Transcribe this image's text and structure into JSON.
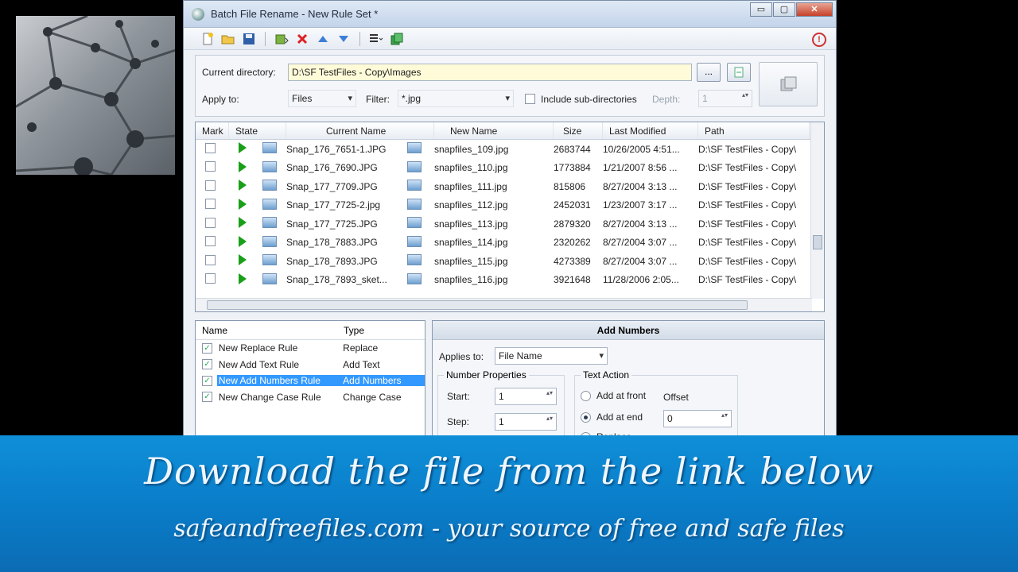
{
  "window": {
    "title": "Batch File Rename - New Rule Set *",
    "controls": [
      "▭",
      "▢",
      "✕"
    ]
  },
  "toolbar": {
    "icons": [
      "new-icon",
      "open-icon",
      "save-icon",
      "add-files-icon",
      "delete-icon",
      "move-up-icon",
      "move-down-icon",
      "list-view-icon",
      "rename-icon"
    ],
    "help": "!"
  },
  "directory": {
    "label": "Current directory:",
    "value": "D:\\SF TestFiles - Copy\\Images",
    "browse_label": "...",
    "apply_label": "Apply to:",
    "apply_value": "Files",
    "filter_label": "Filter:",
    "filter_value": "*.jpg",
    "include_sub_label": "Include sub-directories",
    "depth_label": "Depth:",
    "depth_value": "1"
  },
  "file_table": {
    "columns": [
      "Mark",
      "State",
      "Current Name",
      "New Name",
      "Size",
      "Last Modified",
      "Path"
    ],
    "rows": [
      {
        "current": "Snap_176_7651-1.JPG",
        "new": "snapfiles_109.jpg",
        "size": "2683744",
        "modified": "10/26/2005 4:51...",
        "path": "D:\\SF TestFiles - Copy\\"
      },
      {
        "current": "Snap_176_7690.JPG",
        "new": "snapfiles_110.jpg",
        "size": "1773884",
        "modified": "1/21/2007 8:56 ...",
        "path": "D:\\SF TestFiles - Copy\\"
      },
      {
        "current": "Snap_177_7709.JPG",
        "new": "snapfiles_111.jpg",
        "size": "815806",
        "modified": "8/27/2004 3:13 ...",
        "path": "D:\\SF TestFiles - Copy\\"
      },
      {
        "current": "Snap_177_7725-2.jpg",
        "new": "snapfiles_112.jpg",
        "size": "2452031",
        "modified": "1/23/2007 3:17 ...",
        "path": "D:\\SF TestFiles - Copy\\"
      },
      {
        "current": "Snap_177_7725.JPG",
        "new": "snapfiles_113.jpg",
        "size": "2879320",
        "modified": "8/27/2004 3:13 ...",
        "path": "D:\\SF TestFiles - Copy\\"
      },
      {
        "current": "Snap_178_7883.JPG",
        "new": "snapfiles_114.jpg",
        "size": "2320262",
        "modified": "8/27/2004 3:07 ...",
        "path": "D:\\SF TestFiles - Copy\\"
      },
      {
        "current": "Snap_178_7893.JPG",
        "new": "snapfiles_115.jpg",
        "size": "4273389",
        "modified": "8/27/2004 3:07 ...",
        "path": "D:\\SF TestFiles - Copy\\"
      },
      {
        "current": "Snap_178_7893_sket...",
        "new": "snapfiles_116.jpg",
        "size": "3921648",
        "modified": "11/28/2006 2:05...",
        "path": "D:\\SF TestFiles - Copy\\"
      }
    ]
  },
  "rules": {
    "columns": [
      "Name",
      "Type"
    ],
    "items": [
      {
        "name": "New Replace Rule",
        "type": "Replace",
        "checked": true
      },
      {
        "name": "New Add Text Rule",
        "type": "Add Text",
        "checked": true
      },
      {
        "name": "New Add Numbers Rule",
        "type": "Add Numbers",
        "checked": true,
        "selected": true
      },
      {
        "name": "New Change Case Rule",
        "type": "Change Case",
        "checked": true
      }
    ]
  },
  "properties": {
    "title": "Add Numbers",
    "applies_to_label": "Applies to:",
    "applies_to_value": "File Name",
    "number_group": "Number Properties",
    "start_label": "Start:",
    "start_value": "1",
    "step_label": "Step:",
    "step_value": "1",
    "text_group": "Text Action",
    "add_front": "Add at front",
    "add_end": "Add at end",
    "replace": "Replace",
    "offset_label": "Offset",
    "offset_value": "0"
  },
  "banner": {
    "headline": "Download the file from the link below",
    "sub": "safeandfreefiles.com - your source of free and safe files"
  }
}
